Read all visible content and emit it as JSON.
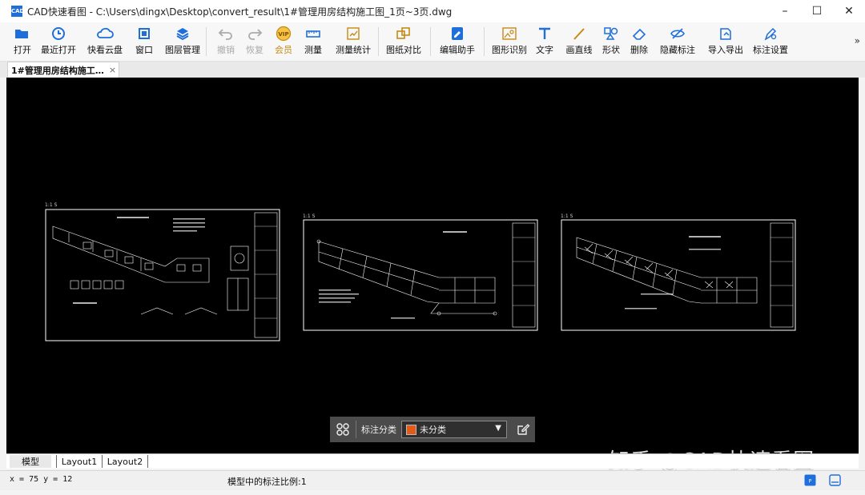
{
  "window": {
    "app_icon_text": "CAD",
    "title": "CAD快速看图 - C:\\Users\\dingx\\Desktop\\convert_result\\1#管理用房结构施工图_1页~3页.dwg",
    "minimize": "–",
    "maximize": "☐",
    "close": "✕"
  },
  "toolbar": {
    "open": "打开",
    "recent": "最近打开",
    "cloud": "快看云盘",
    "window": "窗口",
    "layers": "图层管理",
    "undo": "撤销",
    "redo": "恢复",
    "vip": "会员",
    "measure": "测量",
    "measure_stats": "测量统计",
    "compare": "图纸对比",
    "edit_helper": "编辑助手",
    "shape_recog": "图形识别",
    "text": "文字",
    "draw_line": "画直线",
    "shape": "形状",
    "delete": "删除",
    "hide_annot": "隐藏标注",
    "import_export": "导入导出",
    "annot_settings": "标注设置",
    "more": "»"
  },
  "doc_tab": {
    "title": "1#管理用房结构施工…",
    "close": "×"
  },
  "sheets": [
    {
      "label": "1:1 S"
    },
    {
      "label": "1:1 S"
    },
    {
      "label": "1:1 S"
    }
  ],
  "filter": {
    "label": "标注分类",
    "value": "未分类",
    "swatch_color": "#e35b1a",
    "caret": "▼"
  },
  "layout_tabs": [
    "模型",
    "Layout1",
    "Layout2"
  ],
  "status": {
    "coords": "x = 75  y = 12",
    "scale": "模型中的标注比例:1"
  },
  "watermark": "知乎 @CAD快速看图",
  "colors": {
    "canvas": "#000000",
    "toolbar_icon": "#1e6fd9",
    "vip": "#c58a12"
  }
}
